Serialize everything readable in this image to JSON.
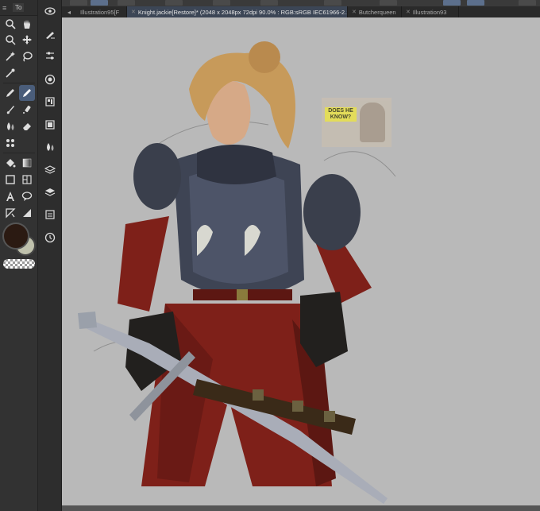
{
  "toolbox": {
    "menu_icon": "≡",
    "tab_label": "To"
  },
  "tabs": [
    {
      "label": "Illustration95[F",
      "active": false
    },
    {
      "label": "Knight.jackie[Restore]* (2048 x 2048px 72dpi 90.0% : RGB:sRGB IEC61966-2.1)",
      "active": true
    },
    {
      "label": "Butcherqueen",
      "active": false
    },
    {
      "label": "Illustration93",
      "active": false
    }
  ],
  "reference_overlay": {
    "text": "DOES HE KNOW?"
  },
  "colors": {
    "main_color": "#2b1a12",
    "sub_color": "#bfc1ac",
    "canvas_background": "#b9b9b9",
    "active_tab": "#3c4656",
    "selected_tool": "#4a5d7a"
  },
  "icons": {
    "tools": [
      "zoom-icon",
      "hand-icon",
      "rotate-icon",
      "move-icon",
      "magic-wand-icon",
      "lasso-icon",
      "eyedropper-icon",
      "pen-icon",
      "pencil-icon",
      "brush-icon",
      "airbrush-icon",
      "blend-icon",
      "eraser-icon",
      "decoration-icon",
      "fill-icon",
      "gradient-icon",
      "rectangle-icon",
      "frame-icon",
      "text-icon",
      "balloon-icon",
      "ruler-icon",
      "correct-line-icon"
    ],
    "subtools": [
      "sub-view-icon",
      "sub-brush-size-icon",
      "sub-settings-icon",
      "sub-navigator-icon",
      "sub-property-icon",
      "sub-layer-icon",
      "sub-color-icon",
      "sub-layers-icon",
      "sub-layer-stack-icon",
      "sub-material-icon",
      "sub-history-icon"
    ]
  }
}
